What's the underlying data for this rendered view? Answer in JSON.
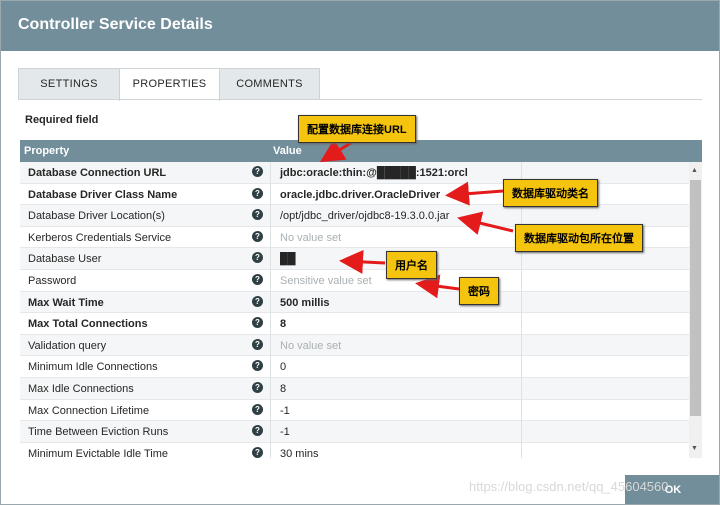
{
  "dialog": {
    "title": "Controller Service Details"
  },
  "tabs": [
    {
      "label": "SETTINGS",
      "active": false
    },
    {
      "label": "PROPERTIES",
      "active": true
    },
    {
      "label": "COMMENTS",
      "active": false
    }
  ],
  "required_label": "Required field",
  "table": {
    "headers": {
      "property": "Property",
      "value": "Value"
    },
    "rows": [
      {
        "name": "Database Connection URL",
        "value": "jdbc:oracle:thin:@█████:1521:orcl",
        "required": true,
        "state": "set"
      },
      {
        "name": "Database Driver Class Name",
        "value": "oracle.jdbc.driver.OracleDriver",
        "required": true,
        "state": "set"
      },
      {
        "name": "Database Driver Location(s)",
        "value": "/opt/jdbc_driver/ojdbc8-19.3.0.0.jar",
        "required": false,
        "state": "set"
      },
      {
        "name": "Kerberos Credentials Service",
        "value": "No value set",
        "required": false,
        "state": "empty"
      },
      {
        "name": "Database User",
        "value": "██",
        "required": false,
        "state": "set"
      },
      {
        "name": "Password",
        "value": "Sensitive value set",
        "required": false,
        "state": "empty"
      },
      {
        "name": "Max Wait Time",
        "value": "500 millis",
        "required": true,
        "state": "set"
      },
      {
        "name": "Max Total Connections",
        "value": "8",
        "required": true,
        "state": "set"
      },
      {
        "name": "Validation query",
        "value": "No value set",
        "required": false,
        "state": "empty"
      },
      {
        "name": "Minimum Idle Connections",
        "value": "0",
        "required": false,
        "state": "set"
      },
      {
        "name": "Max Idle Connections",
        "value": "8",
        "required": false,
        "state": "set"
      },
      {
        "name": "Max Connection Lifetime",
        "value": "-1",
        "required": false,
        "state": "set"
      },
      {
        "name": "Time Between Eviction Runs",
        "value": "-1",
        "required": false,
        "state": "set"
      },
      {
        "name": "Minimum Evictable Idle Time",
        "value": "30 mins",
        "required": false,
        "state": "set"
      }
    ]
  },
  "annotations": {
    "url": "配置数据库连接URL",
    "driver_class": "数据库驱动类名",
    "driver_location": "数据库驱动包所在位置",
    "user": "用户名",
    "password": "密码"
  },
  "buttons": {
    "ok": "OK"
  },
  "watermark": "https://blog.csdn.net/qq_45604560",
  "colors": {
    "header": "#728e9b",
    "annotation_bg": "#f5c40f",
    "arrow": "#e31b1b"
  }
}
